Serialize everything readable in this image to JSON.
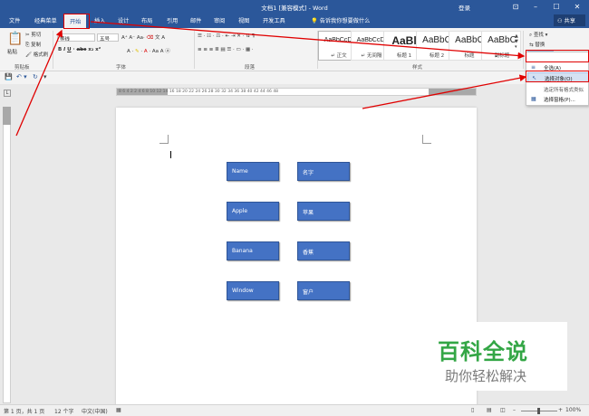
{
  "window": {
    "title": "文档1 [兼容模式] - Word",
    "login": "登录",
    "controls": [
      "⊡",
      "–",
      "☐",
      "✕"
    ]
  },
  "tabs": [
    "文件",
    "经典菜单",
    "开始",
    "插入",
    "设计",
    "布局",
    "引用",
    "邮件",
    "审阅",
    "视图",
    "开发工具"
  ],
  "tell_me": "告诉我你想要做什么",
  "share": "共享",
  "ribbon": {
    "clipboard": {
      "paste": "粘贴",
      "cut": "剪切",
      "copy": "复制",
      "format_painter": "格式刷",
      "label": "剪贴板"
    },
    "font": {
      "name": "等线",
      "size": "五号",
      "label": "字体"
    },
    "paragraph": {
      "label": "段落"
    },
    "styles": {
      "label": "样式",
      "items": [
        {
          "preview": "AaBbCcDı",
          "name": "↵ 正文"
        },
        {
          "preview": "AaBbCcDı",
          "name": "↵ 无间隔"
        },
        {
          "preview": "AaBl",
          "name": "标题 1"
        },
        {
          "preview": "AaBbC",
          "name": "标题 2"
        },
        {
          "preview": "AaBbC",
          "name": "标题"
        },
        {
          "preview": "AaBbC",
          "name": "副标题"
        }
      ]
    },
    "editing": {
      "find": "查找",
      "replace": "替换",
      "select": "选择"
    }
  },
  "select_menu": {
    "items": [
      {
        "label": "全选(A)",
        "icon": "≡"
      },
      {
        "label": "选择对象(O)",
        "icon": "↖"
      },
      {
        "label": "选定所有格式类似",
        "icon": ""
      },
      {
        "label": "选择窗格(P)...",
        "icon": "▦"
      }
    ]
  },
  "ruler": {
    "ticks": "8  6  4  2        2  4  6  8  10  12  14  16  18  20  22  24  26  28  30  32  34  36  38  40  42  44  46  48"
  },
  "document": {
    "cells": [
      [
        "Name",
        "名字"
      ],
      [
        "Apple",
        "苹果"
      ],
      [
        "Banana",
        "香蕉"
      ],
      [
        "Window",
        "窗户"
      ]
    ]
  },
  "status": {
    "page": "第 1 页，共 1 页",
    "words": "12 个字",
    "lang": "中文(中国)",
    "zoom": "100%"
  },
  "watermark": {
    "title": "百科全说",
    "subtitle": "助你轻松解决"
  }
}
